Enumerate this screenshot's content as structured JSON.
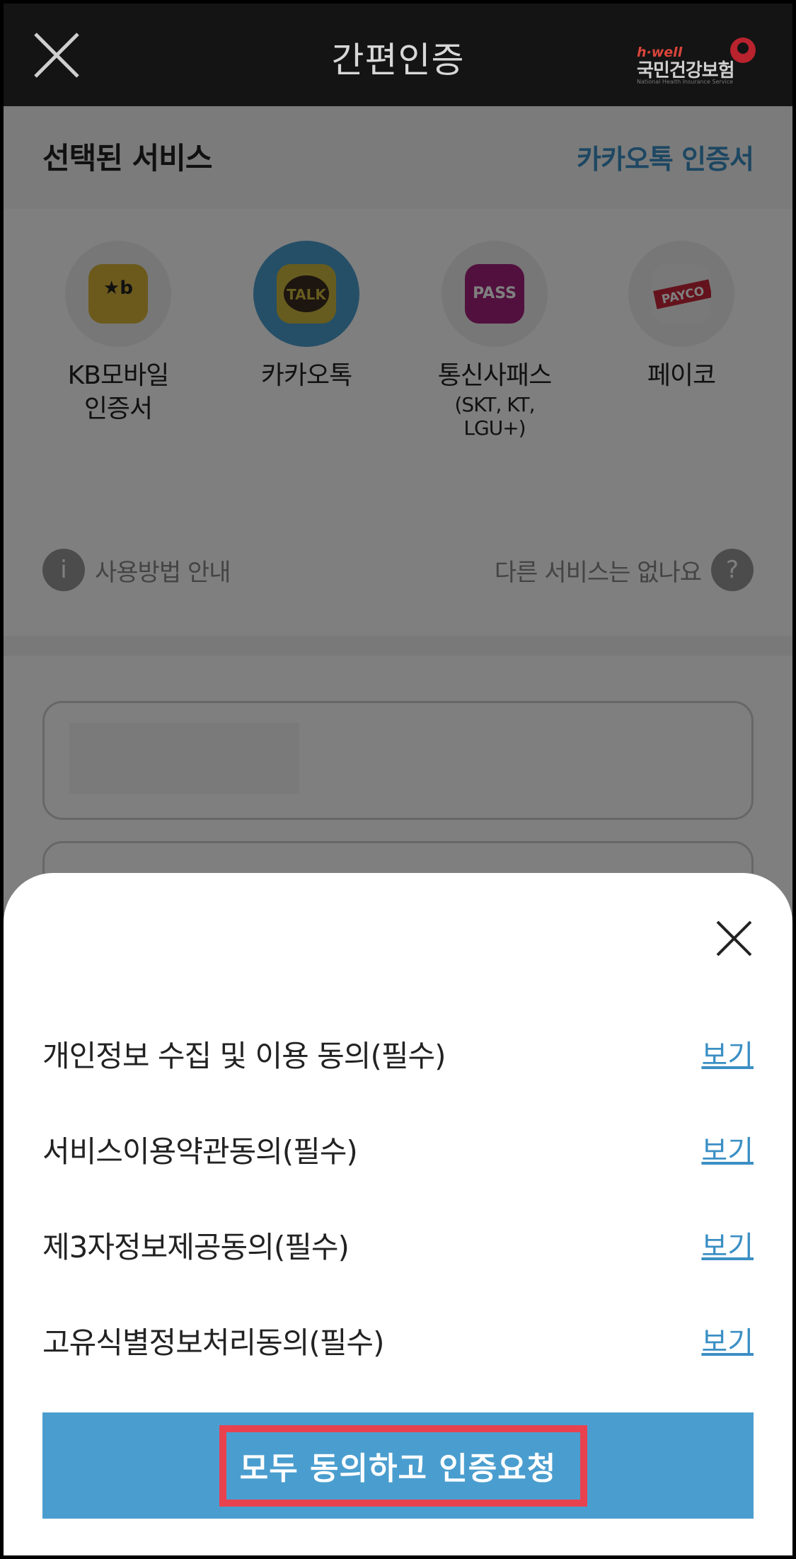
{
  "header": {
    "title": "간편인증",
    "logo_top": "h·well",
    "logo_main": "국민건강보험",
    "logo_sub": "National Health Insurance Service"
  },
  "selected": {
    "label": "선택된 서비스",
    "value": "카카오톡 인증서"
  },
  "services": [
    {
      "name_line1": "KB모바일",
      "name_line2": "인증서",
      "sub": "",
      "tile_text": "KB국민은행",
      "color": "#d9b43a"
    },
    {
      "name_line1": "카카오톡",
      "name_line2": "",
      "sub": "",
      "tile_text": "TALK",
      "color": "#cdb93f"
    },
    {
      "name_line1": "통신사패스",
      "name_line2": "",
      "sub": "(SKT, KT, LGU+)",
      "tile_text": "PASS",
      "color": "#a3217c"
    },
    {
      "name_line1": "페이코",
      "name_line2": "",
      "sub": "",
      "tile_text": "PAYCO",
      "color": "#c8263a"
    }
  ],
  "info": {
    "help_icon": "i",
    "help_text": "사용방법 안내",
    "other_text": "다른 서비스는 없나요",
    "other_icon": "?"
  },
  "terms": [
    {
      "label": "개인정보 수집 및 이용 동의(필수)",
      "link": "보기"
    },
    {
      "label": "서비스이용약관동의(필수)",
      "link": "보기"
    },
    {
      "label": "제3자정보제공동의(필수)",
      "link": "보기"
    },
    {
      "label": "고유식별정보처리동의(필수)",
      "link": "보기"
    }
  ],
  "agree_button": "모두 동의하고 인증요청",
  "colors": {
    "accent": "#4a9ecf",
    "highlight": "#e8424f",
    "header": "#141414"
  }
}
